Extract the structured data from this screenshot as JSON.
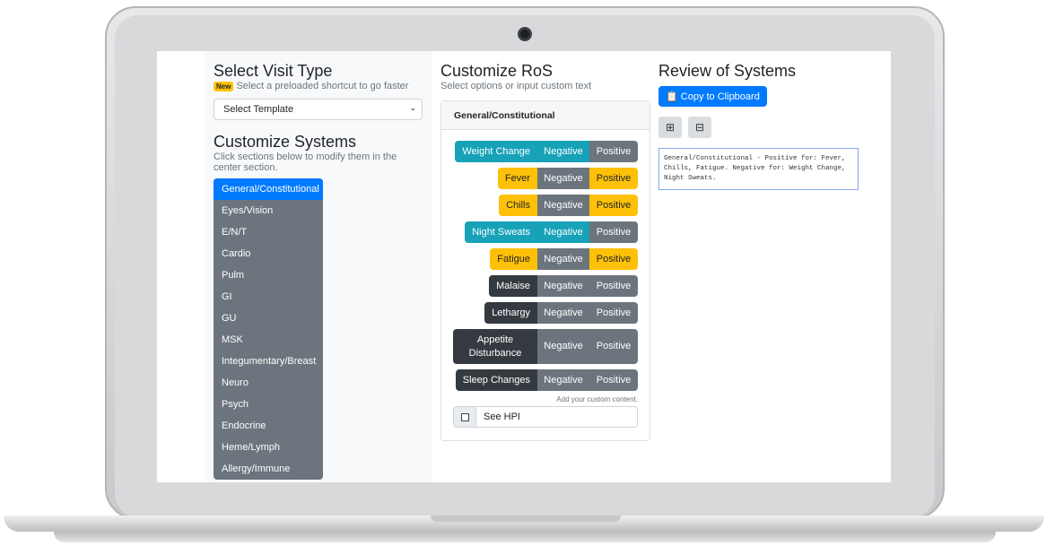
{
  "left": {
    "title": "Select Visit Type",
    "badge": "New",
    "subtitle": "Select a preloaded shortcut to go faster",
    "select_value": "Select Template",
    "systems_title": "Customize Systems",
    "systems_subtitle": "Click sections below to modify them in the center section.",
    "systems": [
      "General/Constitutional",
      "Eyes/Vision",
      "E/N/T",
      "Cardio",
      "Pulm",
      "GI",
      "GU",
      "MSK",
      "Integumentary/Breast",
      "Neuro",
      "Psych",
      "Endocrine",
      "Heme/Lymph",
      "Allergy/Immune"
    ],
    "active_system": "General/Constitutional"
  },
  "mid": {
    "title": "Customize RoS",
    "subtitle": "Select options or input custom text",
    "card_title": "General/Constitutional",
    "negative_label": "Negative",
    "positive_label": "Positive",
    "symptoms": [
      {
        "label": "Weight Change",
        "state": "negative"
      },
      {
        "label": "Fever",
        "state": "positive"
      },
      {
        "label": "Chills",
        "state": "positive"
      },
      {
        "label": "Night Sweats",
        "state": "negative"
      },
      {
        "label": "Fatigue",
        "state": "positive"
      },
      {
        "label": "Malaise",
        "state": "none"
      },
      {
        "label": "Lethargy",
        "state": "none"
      },
      {
        "label": "Appetite Disturbance",
        "state": "none"
      },
      {
        "label": "Sleep Changes",
        "state": "none"
      }
    ],
    "custom_hint": "Add your custom content.",
    "custom_value": "See HPI",
    "custom_checked": false
  },
  "right": {
    "title": "Review of Systems",
    "copy_label": "Copy to Clipboard",
    "expand_icon": "plus-square-icon",
    "collapse_icon": "minus-square-icon",
    "output": "General/Constitutional - Positive for: Fever, Chills, Fatigue. Negative for: Weight Change, Night Sweats."
  },
  "colors": {
    "primary": "#007bff",
    "negative_selected": "#17a2b8",
    "positive_selected": "#ffc107",
    "unselected": "#343a40",
    "secondary": "#6c757d"
  }
}
